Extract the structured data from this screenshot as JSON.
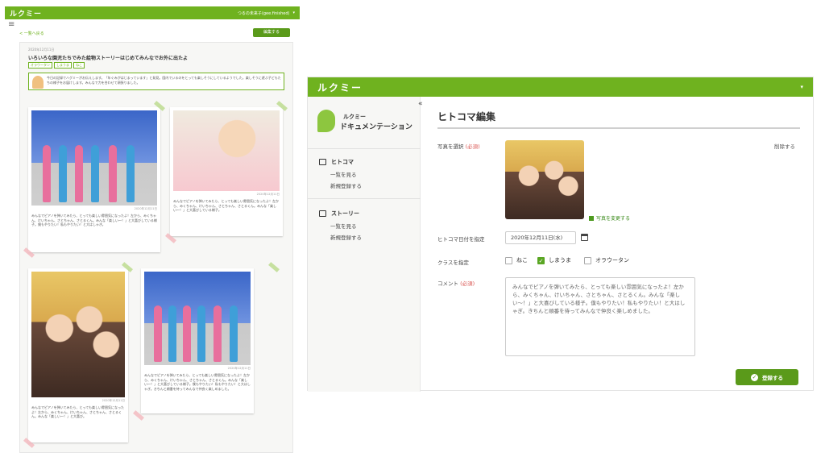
{
  "left": {
    "logo": "ルクミー",
    "user": "つるの未来子(gee.finished)",
    "back_link": "< 一覧へ戻る",
    "edit_button": "編集する",
    "story_date": "2020年12月11日",
    "story_title": "いろいろな園児たちでみた絵物ストーリーはじめてみんなでお外に出たよ",
    "tags": [
      "オラウータン",
      "しまうま",
      "ねこ"
    ],
    "note": "今日の記録でハグミーがお伝えします。「年ぐみがはじまっています」と発見。園内でいるのをとっても楽しそうにしているようでした。楽しそうに遊ぶ子どもたちの様子をお届けします。みんなで力を合わせて頑張りました。",
    "cards": [
      {
        "date": "2020年12月11日",
        "caption": "みんなでピアノを弾いてみたら、とっても楽しい雰囲気になったよ！左から、みくちゃん、けいちゃん、さとちゃん、さとるくん。みんな「楽しい〜！」と大喜びしている様子。僕もやりたい！私もやりたい！と大はしゃぎ。"
      },
      {
        "date": "2020年12月11日",
        "caption": "みんなでピアノを弾いてみたら、とっても楽しい雰囲気になったよ！左から、みくちゃん、けいちゃん、さとちゃん、さとるくん。みんな「楽しい〜！」と大喜びしている様子。"
      },
      {
        "date": "2020年12月11日",
        "caption": "みんなでピアノを弾いてみたら、とっても楽しい雰囲気になったよ！左から、みくちゃん、けいちゃん、さとちゃん、さとるくん。みんな「楽しい〜！」と大喜び。"
      },
      {
        "date": "2020年12月11日",
        "caption": "みんなでピアノを弾いてみたら、とっても楽しい雰囲気になったよ！左から、みくちゃん、けいちゃん、さとちゃん、さとるくん。みんな「楽しい〜！」と大喜びしている様子。僕もやりたい！私もやりたい！と大はしゃぎ。きちんと順番を待ってみんなで仲良く楽しめました。"
      }
    ]
  },
  "right": {
    "logo": "ルクミー",
    "brand_line1": "ルクミー",
    "brand_line2": "ドキュメンテーション",
    "collapse": "«",
    "nav": [
      {
        "heading": "ヒトコマ",
        "items": [
          "一覧を見る",
          "新規登録する"
        ]
      },
      {
        "heading": "ストーリー",
        "items": [
          "一覧を見る",
          "新規登録する"
        ]
      }
    ],
    "page_title": "ヒトコマ編集",
    "photo_label": "写真を選択",
    "required": "(必須)",
    "delete": "削除する",
    "change_photo": "写真を変更する",
    "date_label": "ヒトコマ日付を指定",
    "date_value": "2020年12月11日(水)",
    "class_label": "クラスを指定",
    "classes": [
      {
        "label": "ねこ",
        "checked": false
      },
      {
        "label": "しまうま",
        "checked": true
      },
      {
        "label": "オラウータン",
        "checked": false
      }
    ],
    "comment_label": "コメント",
    "comment_value": "みんなでピアノを弾いてみたら、とっても楽しい雰囲気になったよ！左から、みくちゃん、けいちゃん、さとちゃん、さとるくん。みんな「楽しい〜！」と大喜びしている様子。僕もやりたい！私もやりたい！と大はしゃぎ。きちんと順番を待ってみんなで仲良く楽しめました。",
    "submit": "登録する"
  }
}
